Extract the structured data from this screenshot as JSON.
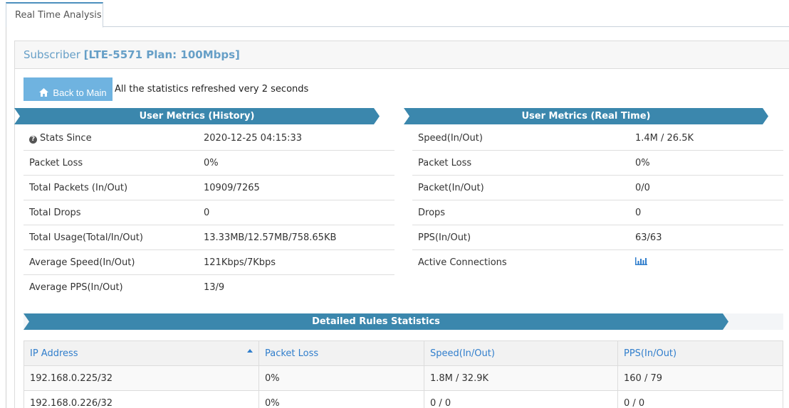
{
  "tab": {
    "label": "Real Time Analysis"
  },
  "panel": {
    "prefix": "Subscriber ",
    "subscriber": "[LTE-5571 Plan: 100Mbps]"
  },
  "toolbar": {
    "back_label": "Back to Main",
    "refresh_note": "All the statistics refreshed very 2 seconds"
  },
  "history": {
    "title": "User Metrics (History)",
    "rows": [
      {
        "label": "Stats Since",
        "value": "2020-12-25 04:15:33"
      },
      {
        "label": "Packet Loss",
        "value": "0%"
      },
      {
        "label": "Total Packets (In/Out)",
        "value": "10909/7265"
      },
      {
        "label": "Total Drops",
        "value": "0"
      },
      {
        "label": "Total Usage(Total/In/Out)",
        "value": "13.33MB/12.57MB/758.65KB"
      },
      {
        "label": "Average Speed(In/Out)",
        "value": "121Kbps/7Kbps"
      },
      {
        "label": "Average PPS(In/Out)",
        "value": "13/9"
      }
    ]
  },
  "realtime": {
    "title": "User Metrics (Real Time)",
    "rows": [
      {
        "label": "Speed(In/Out)",
        "value": "1.4M / 26.5K"
      },
      {
        "label": "Packet Loss",
        "value": "0%"
      },
      {
        "label": "Packet(In/Out)",
        "value": "0/0"
      },
      {
        "label": "Drops",
        "value": "0"
      },
      {
        "label": "PPS(In/Out)",
        "value": "63/63"
      },
      {
        "label": "Active Connections",
        "icon": "bar-chart-icon"
      }
    ]
  },
  "details": {
    "title": "Detailed Rules Statistics",
    "columns": [
      "IP Address",
      "Packet Loss",
      "Speed(In/Out)",
      "PPS(In/Out)"
    ],
    "rows": [
      [
        "192.168.0.225/32",
        "0%",
        "1.8M / 32.9K",
        "160 / 79"
      ],
      [
        "192.168.0.226/32",
        "0%",
        "0 / 0",
        "0 / 0"
      ]
    ]
  },
  "colors": {
    "accent": "#3b87ad",
    "button": "#6fb3e0",
    "link": "#307ecc"
  }
}
